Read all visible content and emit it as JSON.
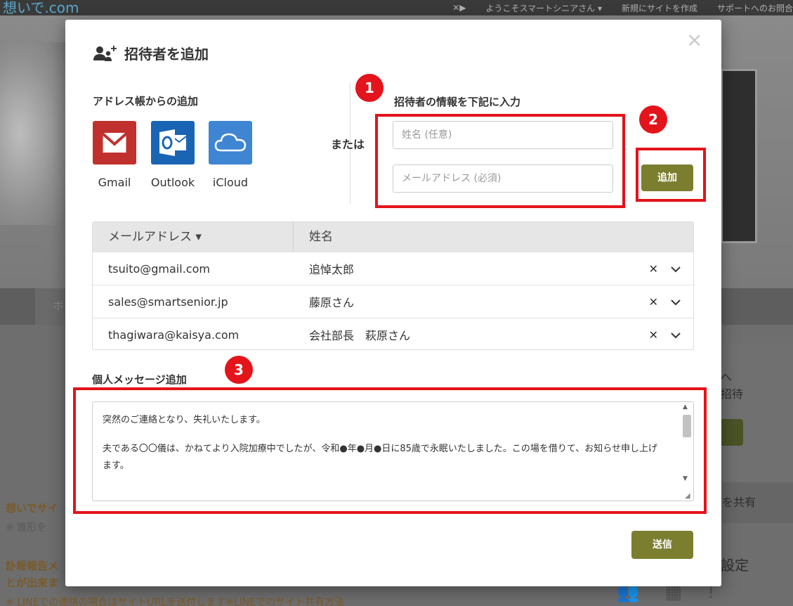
{
  "background": {
    "logo_text": "想いで.com",
    "nav": [
      "ようこそスマートシニアさん ▾",
      "新規にサイトを作成",
      "サポートへのお問合"
    ],
    "left_texts": [
      "想いでサイ",
      "※ 雛形を",
      "訃報報告メ",
      "とが出来ま"
    ],
    "bottom_text": "※ LINEでの連絡の場合はサイトURLを送付します※LINEでのサイト共有方法",
    "right_texts": [
      "へ",
      "招待",
      "を共有",
      "設定"
    ]
  },
  "modal": {
    "title": "招待者を追加",
    "close_symbol": "×",
    "address_book_label": "アドレス帳からの追加",
    "providers": [
      {
        "name": "Gmail",
        "icon": "gmail-icon",
        "color": "#c0312e"
      },
      {
        "name": "Outlook",
        "icon": "outlook-icon",
        "color": "#1a64b4"
      },
      {
        "name": "iCloud",
        "icon": "icloud-icon",
        "color": "#3e86d4"
      }
    ],
    "or_label": "または",
    "manual_label": "招待者の情報を下記に入力",
    "name_placeholder": "姓名 (任意)",
    "email_placeholder": "メールアドレス (必須)",
    "add_button": "追加",
    "table": {
      "col_email": "メールアドレス ▾",
      "col_name": "姓名",
      "rows": [
        {
          "email": "tsuito@gmail.com",
          "name": "追悼太郎"
        },
        {
          "email": "sales@smartsenior.jp",
          "name": "藤原さん"
        },
        {
          "email": "thagiwara@kaisya.com",
          "name": "会社部長　萩原さん"
        }
      ],
      "remove_symbol": "✕",
      "expand_symbol": "⌄"
    },
    "message_label": "個人メッセージ追加",
    "message_lines": [
      "突然のご連絡となり、失礼いたします。",
      "夫である〇〇儀は、かねてより入院加療中でしたが、令和●年●月●日に85歳で永眠いたしました。この場を借りて、お知らせ申し上げます。"
    ],
    "send_button": "送信"
  },
  "annotations": {
    "badges": [
      "1",
      "2",
      "3"
    ],
    "highlight_color": "#e3141b"
  },
  "colors": {
    "accent_button": "#7b7e2f"
  }
}
